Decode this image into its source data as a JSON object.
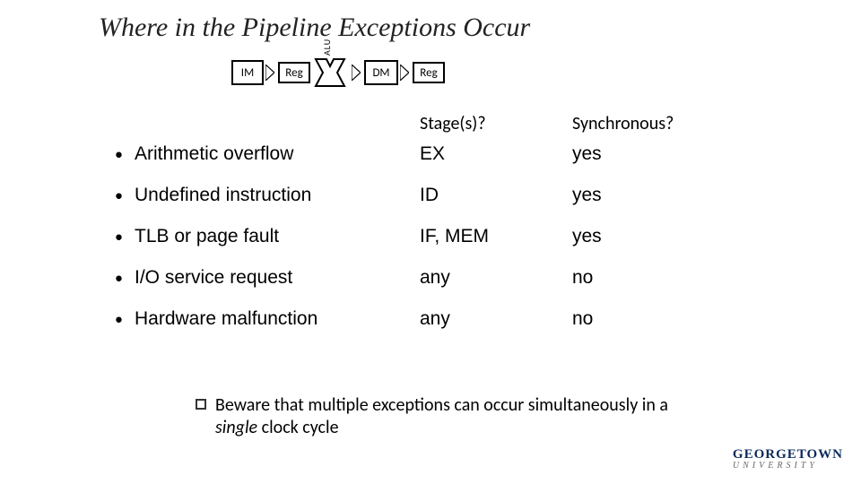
{
  "title": "Where in the Pipeline Exceptions Occur",
  "pipeline": {
    "stages": [
      "IM",
      "Reg",
      "ALU",
      "DM",
      "Reg"
    ]
  },
  "headers": {
    "stage": "Stage(s)?",
    "sync": "Synchronous?"
  },
  "rows": [
    {
      "cause": "Arithmetic overflow",
      "stage": "EX",
      "sync": "yes"
    },
    {
      "cause": "Undefined instruction",
      "stage": "ID",
      "sync": "yes"
    },
    {
      "cause": "TLB or page fault",
      "stage": "IF, MEM",
      "sync": "yes"
    },
    {
      "cause": "I/O service request",
      "stage": "any",
      "sync": "no"
    },
    {
      "cause": "Hardware malfunction",
      "stage": "any",
      "sync": "no"
    }
  ],
  "note_pre": "Beware that multiple exceptions can occur simultaneously in a ",
  "note_italic": "single",
  "note_post": " clock cycle",
  "logo": {
    "top": "GEORGETOWN",
    "bottom": "UNIVERSITY"
  }
}
